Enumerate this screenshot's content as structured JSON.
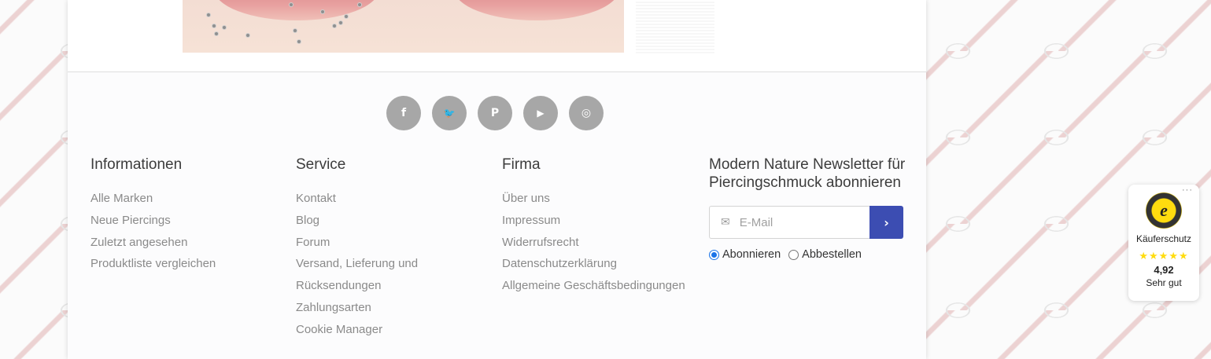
{
  "colors": {
    "accent": "#3c4db2",
    "social_bg": "#a7a7a7",
    "link": "#8a8a8a",
    "heading": "#3c3c3c",
    "stars": "#ffdc0f"
  },
  "social": [
    {
      "icon": "facebook-icon",
      "glyph": "f"
    },
    {
      "icon": "twitter-icon",
      "glyph": "🐦"
    },
    {
      "icon": "pinterest-icon",
      "glyph": "P"
    },
    {
      "icon": "youtube-icon",
      "glyph": "▶"
    },
    {
      "icon": "instagram-icon",
      "glyph": "◎"
    }
  ],
  "footer": {
    "informationen": {
      "title": "Informationen",
      "links": [
        "Alle Marken",
        "Neue Piercings",
        "Zuletzt angesehen",
        "Produktliste vergleichen"
      ]
    },
    "service": {
      "title": "Service",
      "links": [
        "Kontakt",
        "Blog",
        "Forum",
        "Versand, Lieferung und",
        "Rücksendungen",
        "Zahlungsarten",
        "Cookie Manager"
      ]
    },
    "firma": {
      "title": "Firma",
      "links": [
        "Über uns",
        "Impressum",
        "Widerrufsrecht",
        "Datenschutzerklärung",
        "Allgemeine Geschäftsbedingungen"
      ]
    },
    "newsletter": {
      "title": "Modern Nature Newsletter für Piercingschmuck abonnieren",
      "email_placeholder": "E-Mail",
      "mail_icon": "envelope-icon",
      "submit_icon": "chevron-right-icon",
      "options": [
        {
          "label": "Abonnieren",
          "checked": true
        },
        {
          "label": "Abbestellen",
          "checked": false
        }
      ]
    }
  },
  "trusted_shops": {
    "more": "···",
    "seal_letter": "e",
    "label": "Käuferschutz",
    "stars": "★★★★★",
    "score": "4,92",
    "rating_text": "Sehr gut"
  }
}
